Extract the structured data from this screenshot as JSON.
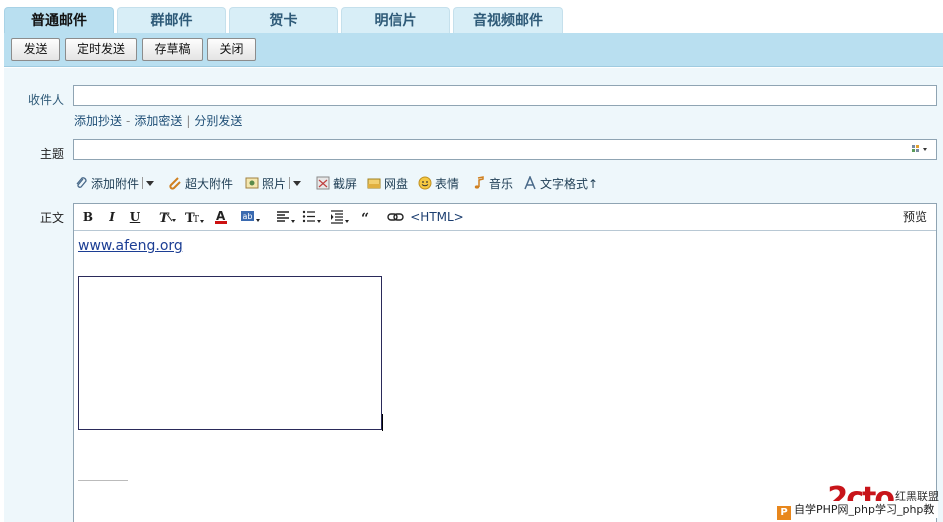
{
  "tabs": [
    {
      "label": "普通邮件",
      "active": true
    },
    {
      "label": "群邮件"
    },
    {
      "label": "贺卡"
    },
    {
      "label": "明信片"
    },
    {
      "label": "音视频邮件"
    }
  ],
  "toolbar": {
    "send": "发送",
    "schedule": "定时发送",
    "draft": "存草稿",
    "close": "关闭"
  },
  "form": {
    "to_label": "收件人",
    "cc_link": "添加抄送",
    "dash": "-",
    "bcc_link": "添加密送",
    "separate_link": "分别发送",
    "subject_label": "主题",
    "body_label": "正文"
  },
  "attachments": {
    "add_attachment": "添加附件",
    "big_attachment": "超大附件",
    "photo": "照片",
    "screenshot": "截屏",
    "netdisk": "网盘",
    "emoji": "表情",
    "music": "音乐",
    "text_format": "文字格式↑"
  },
  "editor": {
    "bold": "B",
    "italic": "I",
    "underline": "U",
    "font": "T",
    "size": "Tт",
    "color": "A",
    "bgcolor": "ab",
    "html_label": "<HTML>",
    "preview": "预览",
    "body_link": "www.afeng.org"
  },
  "watermark": {
    "logo": "2cto",
    "tag": "红黑联盟",
    "caption": "自学PHP网_php学习_php教",
    "p": "P"
  },
  "colors": {
    "tab_active": "#b9dff0",
    "tab_inactive": "#d8eef7",
    "toolbar_bg": "#b9dff0",
    "form_bg": "#eef7fb",
    "link": "#1e4e76"
  }
}
